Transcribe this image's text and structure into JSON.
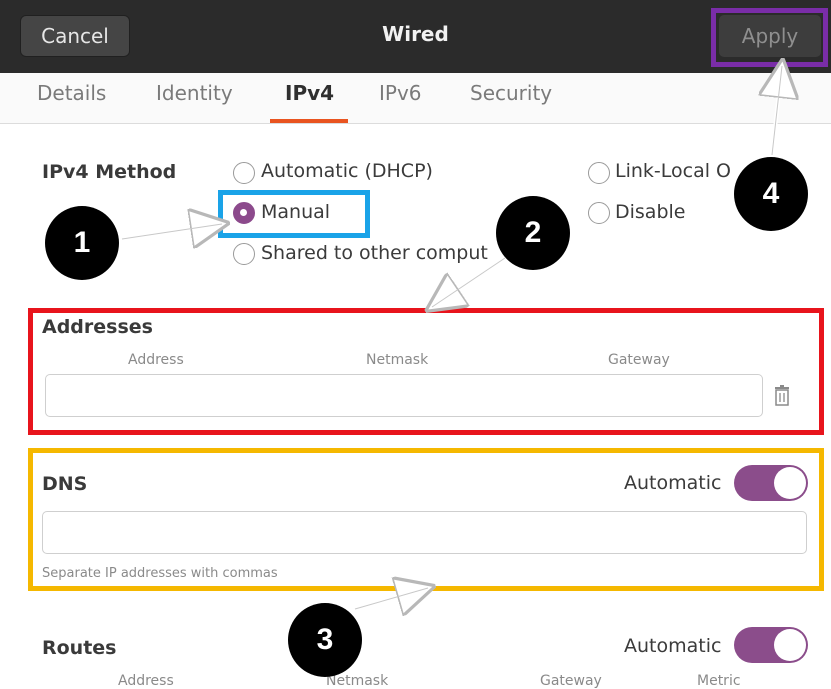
{
  "header": {
    "cancel_label": "Cancel",
    "title": "Wired",
    "apply_label": "Apply"
  },
  "tabs": [
    {
      "label": "Details"
    },
    {
      "label": "Identity"
    },
    {
      "label": "IPv4",
      "active": true
    },
    {
      "label": "IPv6"
    },
    {
      "label": "Security"
    }
  ],
  "ipv4_method": {
    "label": "IPv4 Method",
    "options": [
      {
        "label": "Automatic (DHCP)",
        "selected": false
      },
      {
        "label": "Link-Local O",
        "selected": false
      },
      {
        "label": "Manual",
        "selected": true
      },
      {
        "label": "Disable",
        "selected": false
      },
      {
        "label": "Shared to other comput",
        "selected": false
      }
    ]
  },
  "addresses": {
    "label": "Addresses",
    "columns": [
      "Address",
      "Netmask",
      "Gateway"
    ],
    "row": {
      "address": "",
      "netmask": "",
      "gateway": ""
    },
    "delete_icon": "trash-icon"
  },
  "dns": {
    "label": "DNS",
    "automatic_label": "Automatic",
    "automatic": true,
    "value": "",
    "hint": "Separate IP addresses with commas"
  },
  "routes": {
    "label": "Routes",
    "automatic_label": "Automatic",
    "automatic": true,
    "columns": [
      "Address",
      "Netmask",
      "Gateway",
      "Metric"
    ]
  },
  "annotations": [
    {
      "number": "1",
      "color": "#1aa3e8"
    },
    {
      "number": "2",
      "color": "#e8141c"
    },
    {
      "number": "3",
      "color": "#f5b800"
    },
    {
      "number": "4",
      "color": "#7a2da8"
    }
  ],
  "colors": {
    "accent": "#e95420",
    "selected": "#8c4a8c",
    "header": "#2b2b2b"
  }
}
